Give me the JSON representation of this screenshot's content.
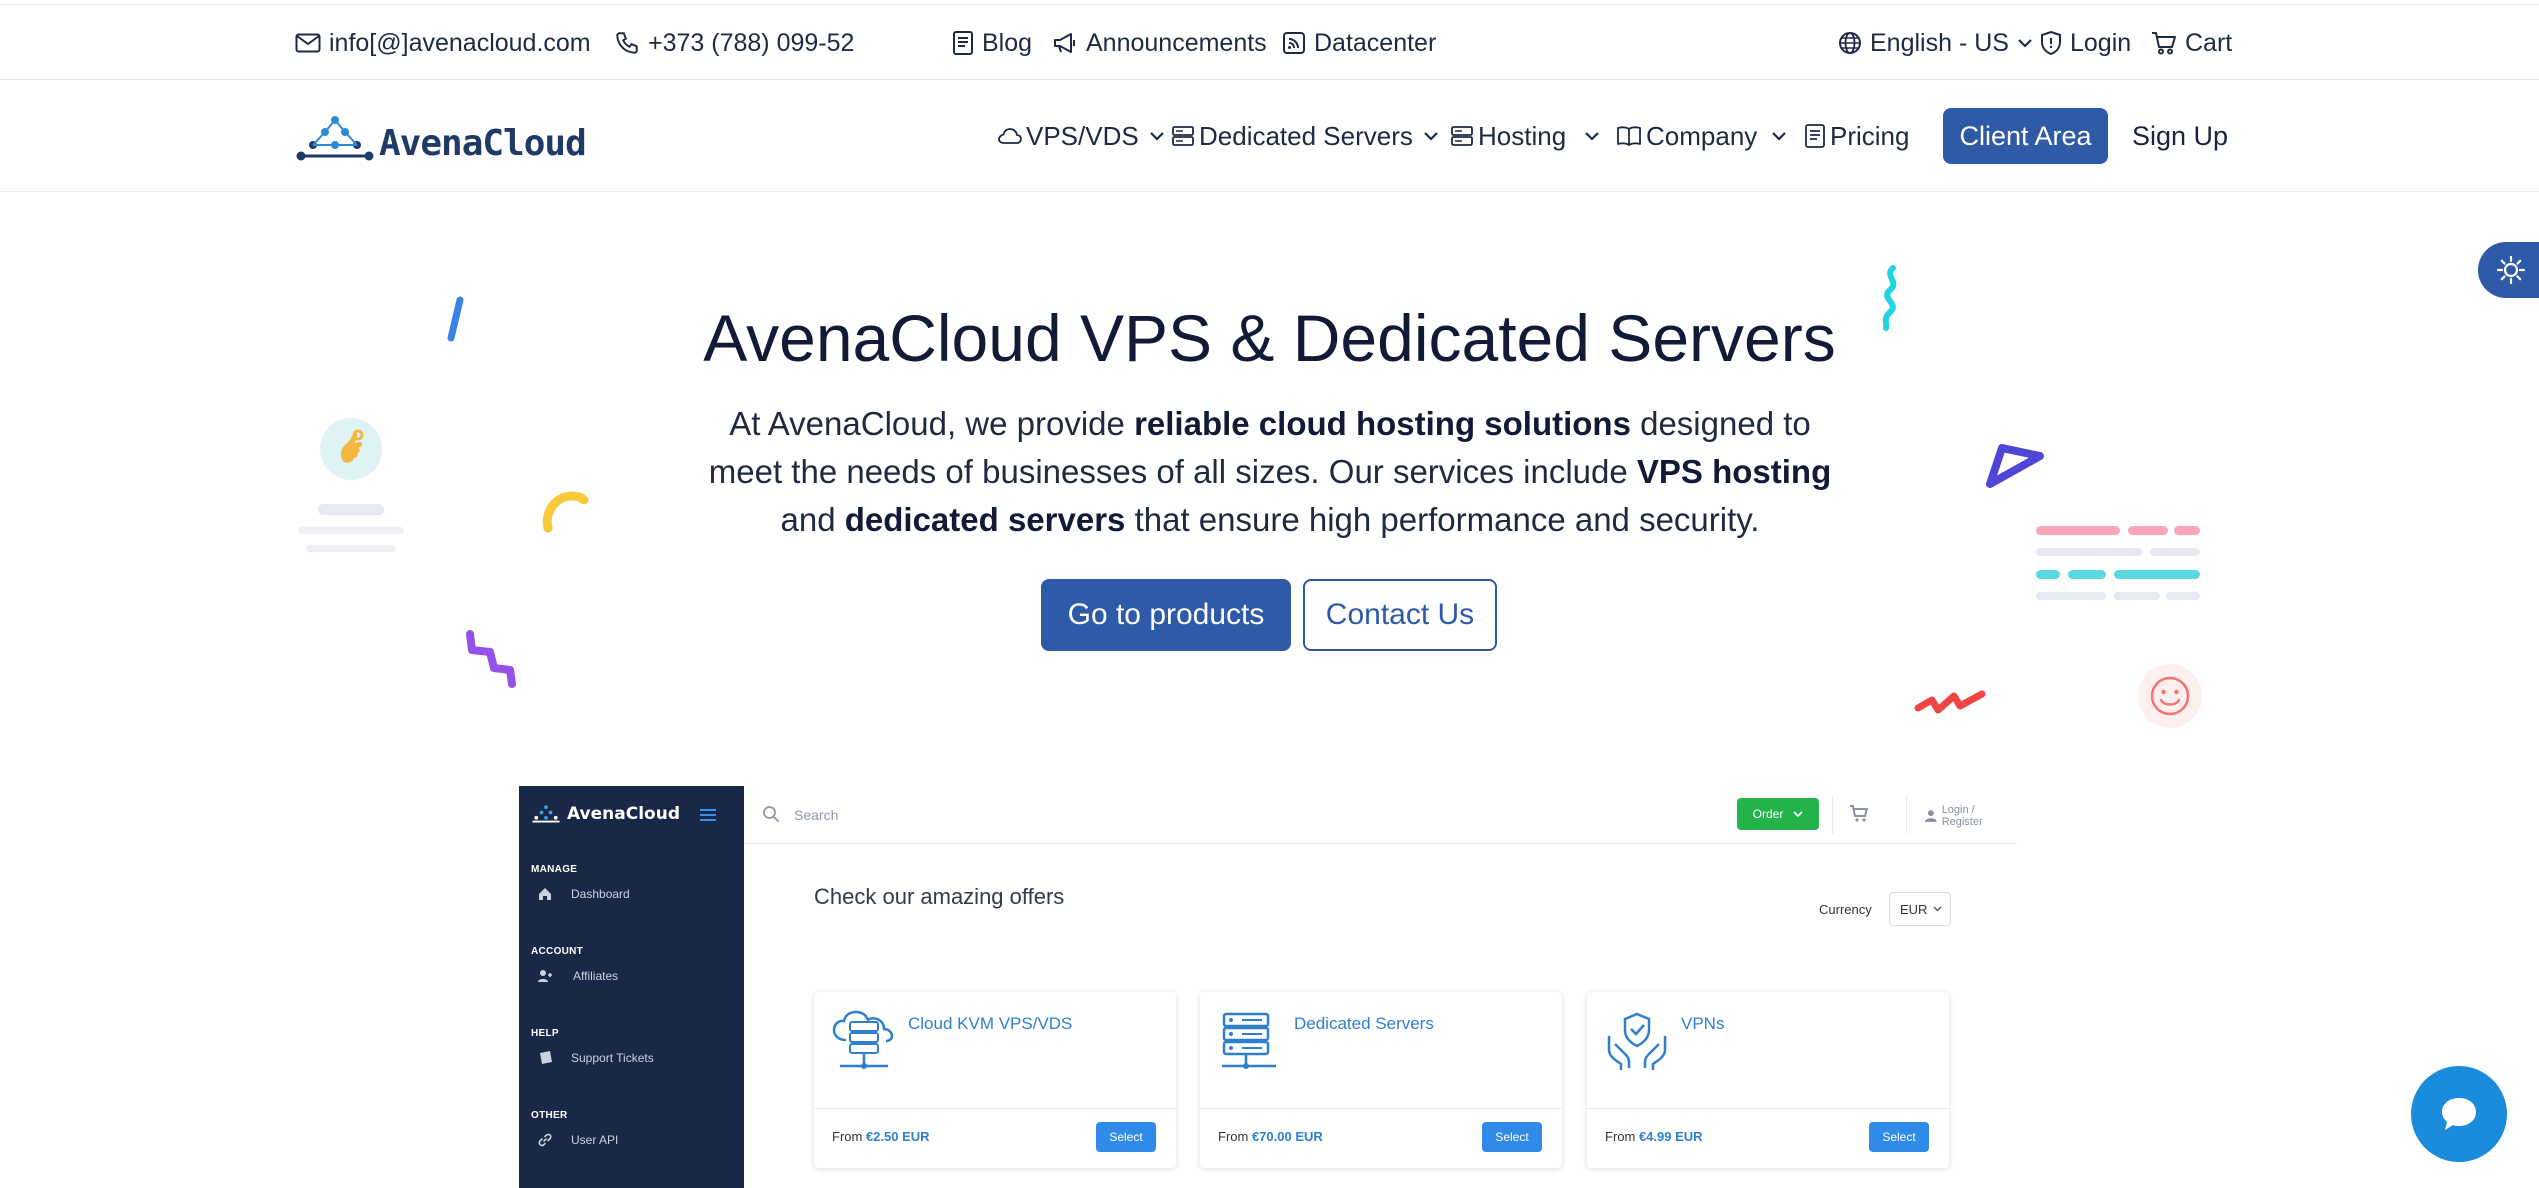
{
  "topbar": {
    "email": "info[@]avenacloud.com",
    "phone": "+373 (788) 099-52",
    "links": [
      "Blog",
      "Announcements",
      "Datacenter"
    ],
    "language": "English - US",
    "login": "Login",
    "cart": "Cart"
  },
  "header": {
    "logo": "AvenaCloud",
    "nav": [
      "VPS/VDS",
      "Dedicated Servers",
      "Hosting",
      "Company",
      "Pricing"
    ],
    "client_area": "Client Area",
    "sign_up": "Sign Up"
  },
  "hero": {
    "title": "AvenaCloud VPS & Dedicated Servers",
    "text_1": "At AvenaCloud, we provide ",
    "bold_1": "reliable cloud hosting solutions",
    "text_2": " designed to meet the needs of businesses of all sizes. Our services include ",
    "bold_2": "VPS hosting",
    "text_3": " and ",
    "bold_3": "dedicated servers",
    "text_4": " that ensure high performance and security.",
    "primary_button": "Go to products",
    "secondary_button": "Contact Us"
  },
  "dashboard": {
    "logo": "AvenaCloud",
    "sections": [
      {
        "title": "MANAGE",
        "item": "Dashboard"
      },
      {
        "title": "ACCOUNT",
        "item": "Affiliates"
      },
      {
        "title": "HELP",
        "item": "Support Tickets"
      },
      {
        "title": "OTHER",
        "item": "User API"
      }
    ],
    "search_placeholder": "Search",
    "order_button": "Order",
    "login_register": "Login / Register",
    "offers_title": "Check our amazing offers",
    "currency_label": "Currency",
    "currency_value": "EUR",
    "cards": [
      {
        "title": "Cloud KVM VPS/VDS",
        "from": "From ",
        "price": "€2.50 EUR",
        "button": "Select"
      },
      {
        "title": "Dedicated Servers",
        "from": "From ",
        "price": "€70.00 EUR",
        "button": "Select"
      },
      {
        "title": "VPNs",
        "from": "From ",
        "price": "€4.99 EUR",
        "button": "Select"
      }
    ]
  },
  "colors": {
    "primary": "#2f5aa8",
    "dashboard_sidebar": "#1a2847",
    "order_green": "#24b24b",
    "link_blue": "#2f7fd0",
    "chat_blue": "#1a8cdb"
  }
}
